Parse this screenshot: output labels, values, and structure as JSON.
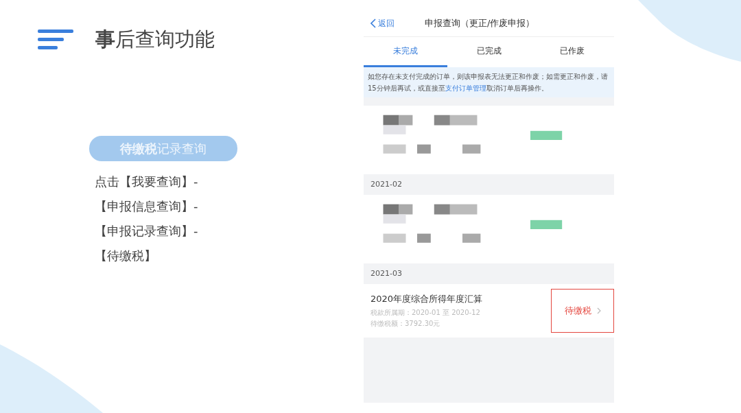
{
  "slide": {
    "title": "**事**后查询功能",
    "badge": "**待缴税**记录查询",
    "steps": [
      "点击【我要查询】-",
      "【申报信息查询】-",
      "【申报记录查询】-",
      "【待缴税】"
    ]
  },
  "phone": {
    "back": "返回",
    "title": "申报查询（更正/作废申报）",
    "tabs": [
      {
        "label": "未完成",
        "selected": true
      },
      {
        "label": "已完成",
        "selected": false
      },
      {
        "label": "已作废",
        "selected": false
      }
    ],
    "notice": {
      "before": "如您存在未支付完成的订单，则该申报表无法更正和作废；如需更正和作废，请15分钟后再试，或直接至",
      "link": "支付订单管理",
      "after": "取消订单后再操作。"
    },
    "groups": [
      {
        "kind": "blurred"
      },
      {
        "kind": "blurred",
        "month": "2021-02"
      },
      {
        "kind": "record",
        "month": "2021-03",
        "record": {
          "title": "2020年度综合所得年度汇算",
          "period": "税款所属期：2020-01 至 2020-12",
          "amount": "待缴税额：3792.30元",
          "status": "待缴税",
          "highlighted": true
        }
      }
    ]
  }
}
